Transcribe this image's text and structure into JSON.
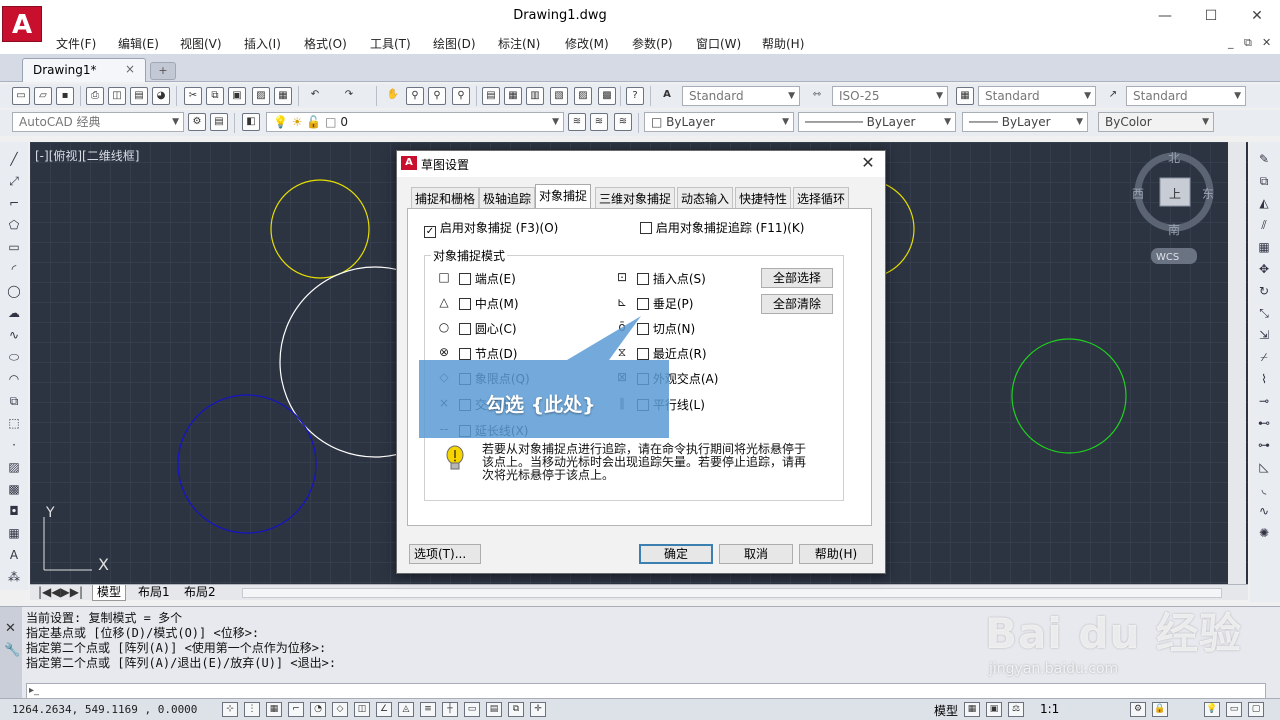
{
  "app": {
    "title": "Drawing1.dwg",
    "logo_letter": "A"
  },
  "menu": [
    "文件(F)",
    "编辑(E)",
    "视图(V)",
    "插入(I)",
    "格式(O)",
    "工具(T)",
    "绘图(D)",
    "标注(N)",
    "修改(M)",
    "参数(P)",
    "窗口(W)",
    "帮助(H)"
  ],
  "document_tab": {
    "label": "Drawing1*",
    "close": "×"
  },
  "toolbar": {
    "text_style": "Standard",
    "dim_style": "ISO-25",
    "table_style": "Standard",
    "mleader_style": "Standard",
    "workspace": "AutoCAD 经典",
    "layer": "0",
    "color": "ByLayer",
    "linetype": "ByLayer",
    "lineweight": "ByLayer",
    "plotstyle": "ByColor"
  },
  "drawing": {
    "view_label": "[-][俯视][二维线框]",
    "viewcube": {
      "north": "北",
      "south": "南",
      "east": "东",
      "west": "西",
      "face": "上",
      "wcs": "WCS"
    },
    "ucs_y": "Y",
    "ucs_x": "X",
    "colors": {
      "background": "#2c3341",
      "circle_yellow": "#e6e000",
      "circle_white": "#ffffff",
      "circle_blue": "#1414c8",
      "circle_green": "#1ed21e"
    }
  },
  "layout_tabs": [
    "模型",
    "布局1",
    "布局2"
  ],
  "dialog": {
    "title": "草图设置",
    "tabs": [
      "捕捉和栅格",
      "极轴追踪",
      "对象捕捉",
      "三维对象捕捉",
      "动态输入",
      "快捷特性",
      "选择循环"
    ],
    "active_tab": "对象捕捉",
    "enable_osnap": "启用对象捕捉 (F3)(O)",
    "enable_osnap_checked": true,
    "enable_tracking": "启用对象捕捉追踪 (F11)(K)",
    "enable_tracking_checked": false,
    "group_label": "对象捕捉模式",
    "modes_left": [
      {
        "symbol": "□",
        "label": "端点(E)"
      },
      {
        "symbol": "△",
        "label": "中点(M)"
      },
      {
        "symbol": "○",
        "label": "圆心(C)"
      },
      {
        "symbol": "⊗",
        "label": "节点(D)"
      },
      {
        "symbol": "◇",
        "label": "象限点(Q)"
      },
      {
        "symbol": "×",
        "label": "交点(I)"
      },
      {
        "symbol": "--",
        "label": "延长线(X)"
      }
    ],
    "modes_right": [
      {
        "symbol": "⊡",
        "label": "插入点(S)"
      },
      {
        "symbol": "⊾",
        "label": "垂足(P)"
      },
      {
        "symbol": "ō",
        "label": "切点(N)"
      },
      {
        "symbol": "⧖",
        "label": "最近点(R)"
      },
      {
        "symbol": "⊠",
        "label": "外观交点(A)"
      },
      {
        "symbol": "∥",
        "label": "平行线(L)"
      }
    ],
    "select_all": "全部选择",
    "clear_all": "全部清除",
    "tip": "若要从对象捕捉点进行追踪，请在命令执行期间将光标悬停于该点上。当移动光标时会出现追踪矢量。若要停止追踪，请再次将光标悬停于该点上。",
    "options_button": "选项(T)...",
    "ok_button": "确定",
    "cancel_button": "取消",
    "help_button": "帮助(H)",
    "close": "✕"
  },
  "callout": {
    "text": "勾选 {此处}",
    "color": "#5b9bd5"
  },
  "command": {
    "history": [
      "当前设置:  复制模式 = 多个",
      "指定基点或 [位移(D)/模式(O)] <位移>:",
      "指定第二个点或 [阵列(A)] <使用第一个点作为位移>:",
      "指定第二个点或 [阵列(A)/退出(E)/放弃(U)] <退出>:"
    ]
  },
  "status": {
    "coords": "1264.2634, 549.1169 , 0.0000",
    "model": "模型",
    "scale": "1:1"
  },
  "watermark": {
    "logo": "Bai du 经验",
    "url": "jingyan.baidu.com"
  }
}
